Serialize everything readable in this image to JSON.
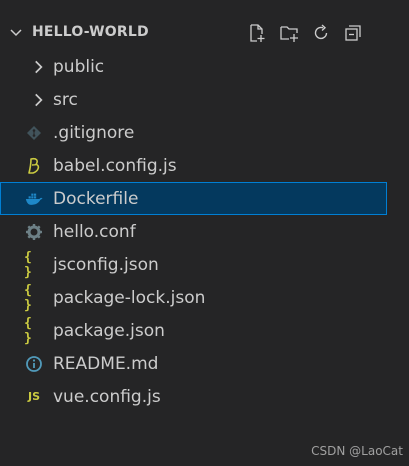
{
  "explorer": {
    "folder_title": "HELLO-WORLD",
    "actions": [
      {
        "name": "new-file-icon"
      },
      {
        "name": "new-folder-icon"
      },
      {
        "name": "refresh-icon"
      },
      {
        "name": "collapse-all-icon"
      }
    ],
    "items": [
      {
        "label": "public",
        "icon": "chevron-right-icon",
        "type": "folder"
      },
      {
        "label": "src",
        "icon": "chevron-right-icon",
        "type": "folder"
      },
      {
        "label": ".gitignore",
        "icon": "git-icon",
        "type": "file"
      },
      {
        "label": "babel.config.js",
        "icon": "babel-icon",
        "type": "file"
      },
      {
        "label": "Dockerfile",
        "icon": "docker-icon",
        "type": "file",
        "selected": true
      },
      {
        "label": "hello.conf",
        "icon": "gear-icon",
        "type": "file"
      },
      {
        "label": "jsconfig.json",
        "icon": "json-braces-icon",
        "type": "file"
      },
      {
        "label": "package-lock.json",
        "icon": "json-braces-icon",
        "type": "file"
      },
      {
        "label": "package.json",
        "icon": "json-braces-icon",
        "type": "file"
      },
      {
        "label": "README.md",
        "icon": "info-icon",
        "type": "file"
      },
      {
        "label": "vue.config.js",
        "icon": "js-icon",
        "type": "file"
      }
    ],
    "icon_glyphs": {
      "json": "{ }",
      "js": "JS"
    }
  },
  "watermark": "CSDN @LaoCat",
  "colors": {
    "background": "#252526",
    "selection": "#04395e",
    "selection_border": "#007fd4",
    "json_yellow": "#cbcb41",
    "docker_blue": "#1e88c8",
    "info_blue": "#519aba"
  }
}
